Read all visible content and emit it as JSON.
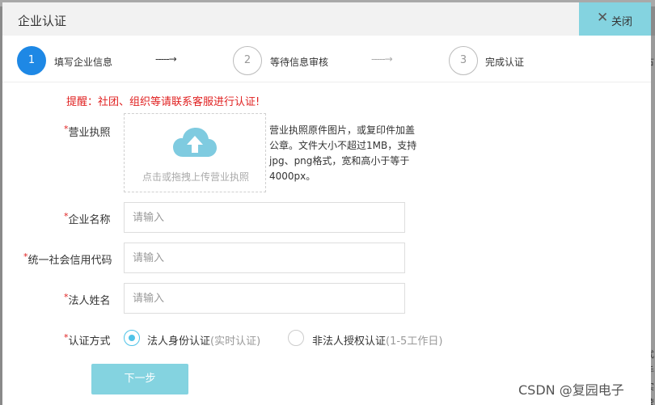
{
  "modal": {
    "title": "企业认证",
    "close_label": "关闭"
  },
  "steps": [
    {
      "number": "1",
      "label": "填写企业信息",
      "active": true
    },
    {
      "number": "2",
      "label": "等待信息审核",
      "active": false
    },
    {
      "number": "3",
      "label": "完成认证",
      "active": false
    }
  ],
  "arrows": [
    "-----→",
    "-----→"
  ],
  "notice": "提醒：社团、组织等请联系客服进行认证!",
  "form": {
    "required_mark": "*",
    "license": {
      "label": "营业执照",
      "upload_text": "点击或拖拽上传营业执照",
      "hint": "营业执照原件图片，或复印件加盖公章。文件大小不超过1MB，支持jpg、png格式，宽和高小于等于4000px。"
    },
    "company_name": {
      "label": "企业名称",
      "placeholder": "请输入"
    },
    "credit_code": {
      "label": "统一社会信用代码",
      "placeholder": "请输入"
    },
    "legal_name": {
      "label": "法人姓名",
      "placeholder": "请输入"
    },
    "auth_method": {
      "label": "认证方式",
      "options": [
        {
          "label": "法人身份认证",
          "sub": "(实时认证)",
          "checked": true
        },
        {
          "label": "非法人授权认证",
          "sub": "(1-5工作日)",
          "checked": false
        }
      ]
    },
    "next_label": "下一步"
  },
  "watermark": "CSDN @复园电子",
  "colors": {
    "accent": "#84d3e0",
    "primary": "#1e88e5",
    "warning": "#e02020"
  }
}
